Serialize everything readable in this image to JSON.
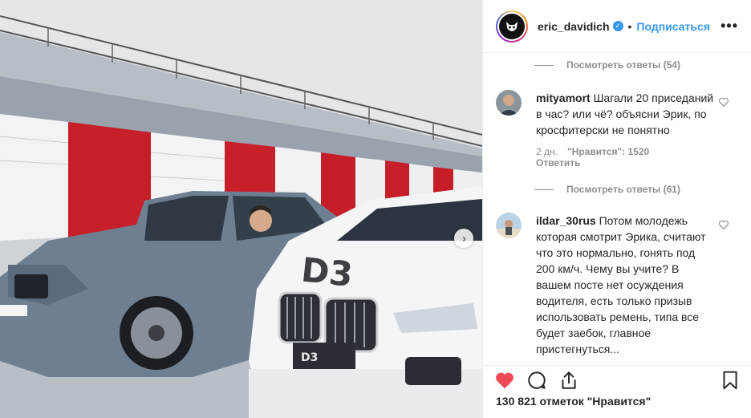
{
  "post": {
    "username": "eric_davidich",
    "separator": "•",
    "follow_label": "Подписаться",
    "more_label": "•••",
    "carousel_next": "›"
  },
  "comments": [
    {
      "type": "replies",
      "label": "Посмотреть ответы (54)"
    },
    {
      "type": "comment",
      "user": "mityamort",
      "text": "Шагали 20 приседаний в час? или чё? объясни Эрик, по кросфитерски не понятно",
      "age": "2 дн.",
      "likes": "\"Нравится\": 1520",
      "reply_label": "Ответить"
    },
    {
      "type": "replies",
      "label": "Посмотреть ответы (61)"
    },
    {
      "type": "comment",
      "user": "ildar_30rus",
      "text": "Потом молодежь которая смотрит Эрика, считают что это нормально, гонять под 200 км/ч. Чему вы учите? В вашем посте нет осуждения водителя, есть только призыв использовать ремень, типа все будет заебок, главное пристегнуться..."
    }
  ],
  "footer": {
    "likes_number": "130 821",
    "likes_label": "отметок \"Нравится\""
  },
  "colors": {
    "accent": "#3897f0",
    "heart": "#ed4956",
    "muted": "#8e8e8e"
  },
  "icons": [
    "verified-badge-icon",
    "heart-icon",
    "comment-icon",
    "share-icon",
    "bookmark-icon",
    "chevron-right-icon"
  ]
}
